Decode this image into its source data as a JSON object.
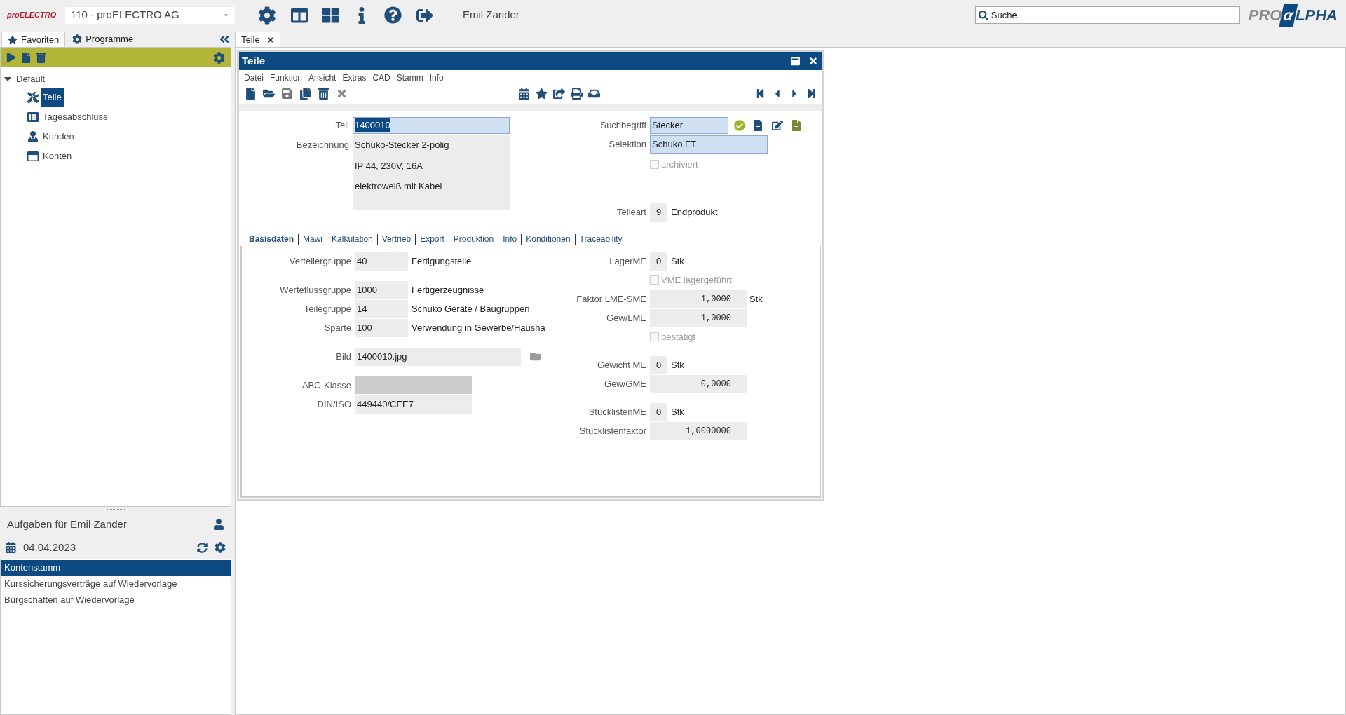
{
  "header": {
    "logo": "proELECTRO",
    "company": "110 - proELECTRO AG",
    "user": "Emil Zander",
    "search": {
      "placeholder": "Suche"
    },
    "brand": {
      "left": "PRO",
      "mark": "α",
      "right": "LPHA"
    }
  },
  "sidebar": {
    "tabs": [
      {
        "label": "Favoriten",
        "selected": true
      },
      {
        "label": "Programme",
        "selected": false
      }
    ],
    "tree": [
      {
        "label": "Default",
        "expanded": true,
        "children": [
          {
            "label": "Teile",
            "selected": true,
            "kind": "part"
          },
          {
            "label": "Tagesabschluss",
            "selected": false,
            "kind": "window"
          },
          {
            "label": "Kunden",
            "selected": false,
            "kind": "person"
          },
          {
            "label": "Konten",
            "selected": false,
            "kind": "frame"
          }
        ]
      }
    ]
  },
  "tasks": {
    "title": "Aufgaben für Emil Zander",
    "date": "04.04.2023",
    "items": [
      {
        "label": "Kontenstamm",
        "selected": true
      },
      {
        "label": "Kurssicherungsverträge auf Wiedervorlage",
        "selected": false
      },
      {
        "label": "Bürgschaften auf Wiedervorlage",
        "selected": false
      }
    ]
  },
  "doc_tabs": [
    {
      "label": "Teile",
      "selected": true
    }
  ],
  "window": {
    "title": "Teile",
    "menu": [
      "Datei",
      "Funktion",
      "Ansicht",
      "Extras",
      "CAD",
      "Stamm",
      "Info"
    ],
    "part": {
      "teil": {
        "label": "Teil",
        "value": "1400010",
        "highlighted": true
      },
      "bezeichnung": {
        "label": "Bezeichnung",
        "lines": [
          "Schuko-Stecker 2-polig",
          "IP 44, 230V, 16A",
          "elektroweiß mit Kabel"
        ]
      },
      "suchbegriff": {
        "label": "Suchbegriff",
        "value": "Stecker"
      },
      "selektion": {
        "label": "Selektion",
        "value": "Schuko FT"
      },
      "archiviert": {
        "label": "archiviert",
        "checked": false,
        "disabled": true
      },
      "teileart": {
        "label": "Teileart",
        "value": "9",
        "description": "Endprodukt"
      }
    },
    "tabs": [
      {
        "label": "Basisdaten",
        "selected": true
      },
      {
        "label": "Mawi",
        "selected": false
      },
      {
        "label": "Kalkulation",
        "selected": false
      },
      {
        "label": "Vertrieb",
        "selected": false
      },
      {
        "label": "Export",
        "selected": false
      },
      {
        "label": "Produktion",
        "selected": false
      },
      {
        "label": "Info",
        "selected": false
      },
      {
        "label": "Konditionen",
        "selected": false
      },
      {
        "label": "Traceability",
        "selected": false
      }
    ],
    "basisdaten": {
      "left": [
        [
          {
            "kind": "code",
            "label": "Verteilergruppe",
            "value": "40",
            "description": "Fertigungsteile"
          }
        ],
        [
          {
            "kind": "code",
            "label": "Werteflussgruppe",
            "value": "1000",
            "description": "Fertigerzeugnisse"
          },
          {
            "kind": "code",
            "label": "Teilegruppe",
            "value": "14",
            "description": "Schuko Geräte / Baugruppen"
          },
          {
            "kind": "code",
            "label": "Sparte",
            "value": "100",
            "description": "Verwendung in Gewerbe/Hausha"
          }
        ],
        [
          {
            "kind": "file",
            "label": "Bild",
            "value": "1400010.jpg"
          }
        ],
        [
          {
            "kind": "select",
            "label": "ABC-Klasse"
          },
          {
            "kind": "text",
            "label": "DIN/ISO",
            "value": "449440/CEE7"
          }
        ]
      ],
      "right": [
        [
          {
            "kind": "unit",
            "label": "LagerME",
            "value": "0",
            "unit": "Stk"
          },
          {
            "kind": "checkbox",
            "label": "VME lagergeführt",
            "checked": false,
            "disabled": true
          },
          {
            "kind": "number",
            "label": "Faktor LME-SME",
            "value": "1,0000",
            "unit": "Stk"
          },
          {
            "kind": "number",
            "label": "Gew/LME",
            "value": "1,0000"
          },
          {
            "kind": "checkbox",
            "label": "bestätigt",
            "checked": false,
            "disabled": true
          }
        ],
        [
          {
            "kind": "unit",
            "label": "Gewicht ME",
            "value": "0",
            "unit": "Stk"
          },
          {
            "kind": "number",
            "label": "Gew/GME",
            "value": "0,0000"
          }
        ],
        [
          {
            "kind": "unit",
            "label": "StücklistenME",
            "value": "0",
            "unit": "Stk"
          },
          {
            "kind": "number",
            "label": "Stücklistenfaktor",
            "value": "1,0000000"
          }
        ]
      ]
    }
  }
}
